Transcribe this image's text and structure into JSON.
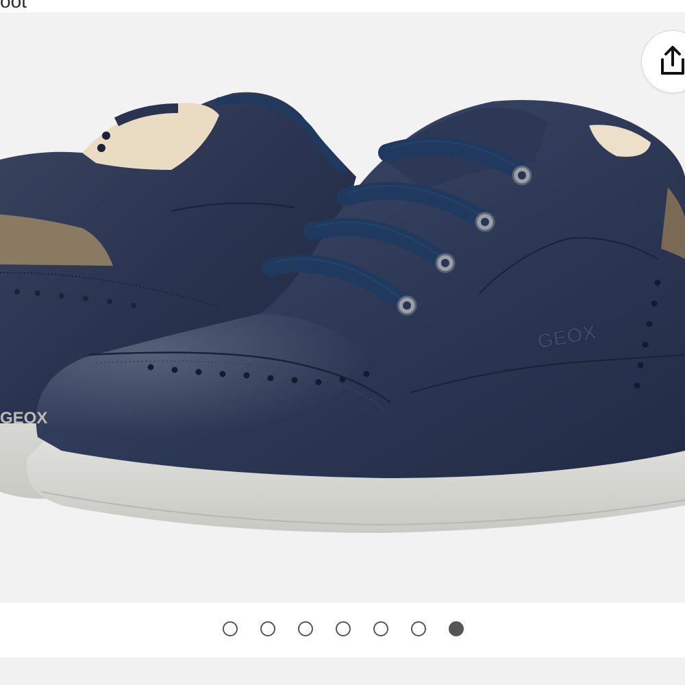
{
  "header": {
    "partial_title": "oot"
  },
  "product_image": {
    "alt": "",
    "logo_text_upper": "GEOX",
    "logo_text_sole": "GEOX"
  },
  "share": {
    "icon": "share-icon"
  },
  "carousel": {
    "total": 7,
    "active_index": 6
  },
  "colors": {
    "shoe_leather": "#2b3551",
    "laces": "#1f3a5e",
    "sole": "#d6d6d3",
    "suede_accent": "#8a7a62",
    "background": "#f2f2f3"
  }
}
